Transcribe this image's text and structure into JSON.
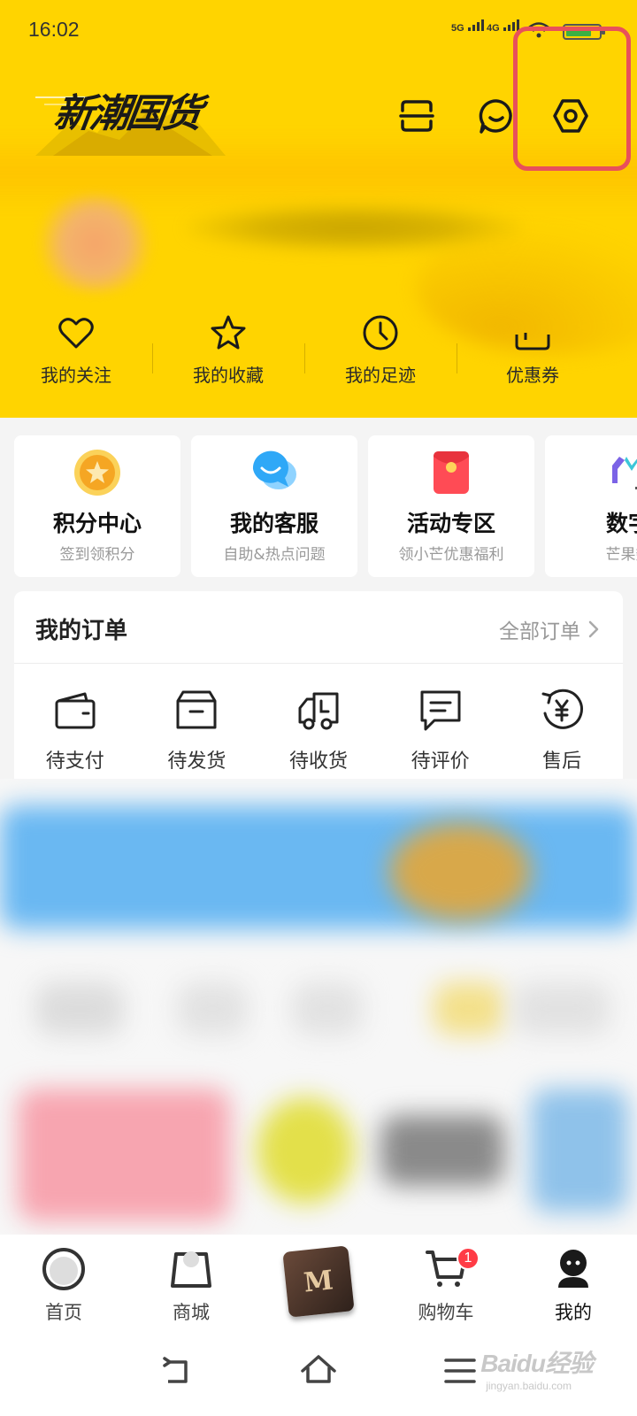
{
  "status_bar": {
    "time": "16:02",
    "signal_1": "5G",
    "signal_2": "4G"
  },
  "header": {
    "logo_text": "新潮国货",
    "icons": [
      "scan-icon",
      "message-icon",
      "settings-icon"
    ]
  },
  "quick_links": [
    {
      "label": "我的关注",
      "icon": "heart-icon"
    },
    {
      "label": "我的收藏",
      "icon": "star-icon"
    },
    {
      "label": "我的足迹",
      "icon": "clock-icon"
    },
    {
      "label": "优惠券",
      "icon": "coupon-icon"
    }
  ],
  "feature_cards": [
    {
      "title": "积分中心",
      "subtitle": "签到领积分",
      "icon": "points-coin-icon"
    },
    {
      "title": "我的客服",
      "subtitle": "自助&热点问题",
      "icon": "chat-bubble-icon"
    },
    {
      "title": "活动专区",
      "subtitle": "领小芒优惠福利",
      "icon": "red-envelope-icon"
    },
    {
      "title": "数字",
      "subtitle": "芒果数",
      "icon": "digital-logo-icon"
    }
  ],
  "orders": {
    "title": "我的订单",
    "view_all": "全部订单",
    "statuses": [
      {
        "label": "待支付",
        "icon": "wallet-icon"
      },
      {
        "label": "待发货",
        "icon": "box-icon"
      },
      {
        "label": "待收货",
        "icon": "truck-icon"
      },
      {
        "label": "待评价",
        "icon": "comment-icon"
      },
      {
        "label": "售后",
        "icon": "refund-icon"
      }
    ]
  },
  "bottom_nav": [
    {
      "label": "首页",
      "icon": "home-icon"
    },
    {
      "label": "商城",
      "icon": "shop-bag-icon"
    },
    {
      "label": "",
      "icon": "center-promo-icon"
    },
    {
      "label": "购物车",
      "icon": "cart-icon",
      "badge": "1"
    },
    {
      "label": "我的",
      "icon": "profile-icon",
      "active": true
    }
  ],
  "colors": {
    "header_bg": "#ffd400",
    "highlight_border": "#e8505b",
    "badge": "#ff3b45"
  },
  "watermark": {
    "brand": "Baidu经验",
    "url": "jingyan.baidu.com"
  }
}
